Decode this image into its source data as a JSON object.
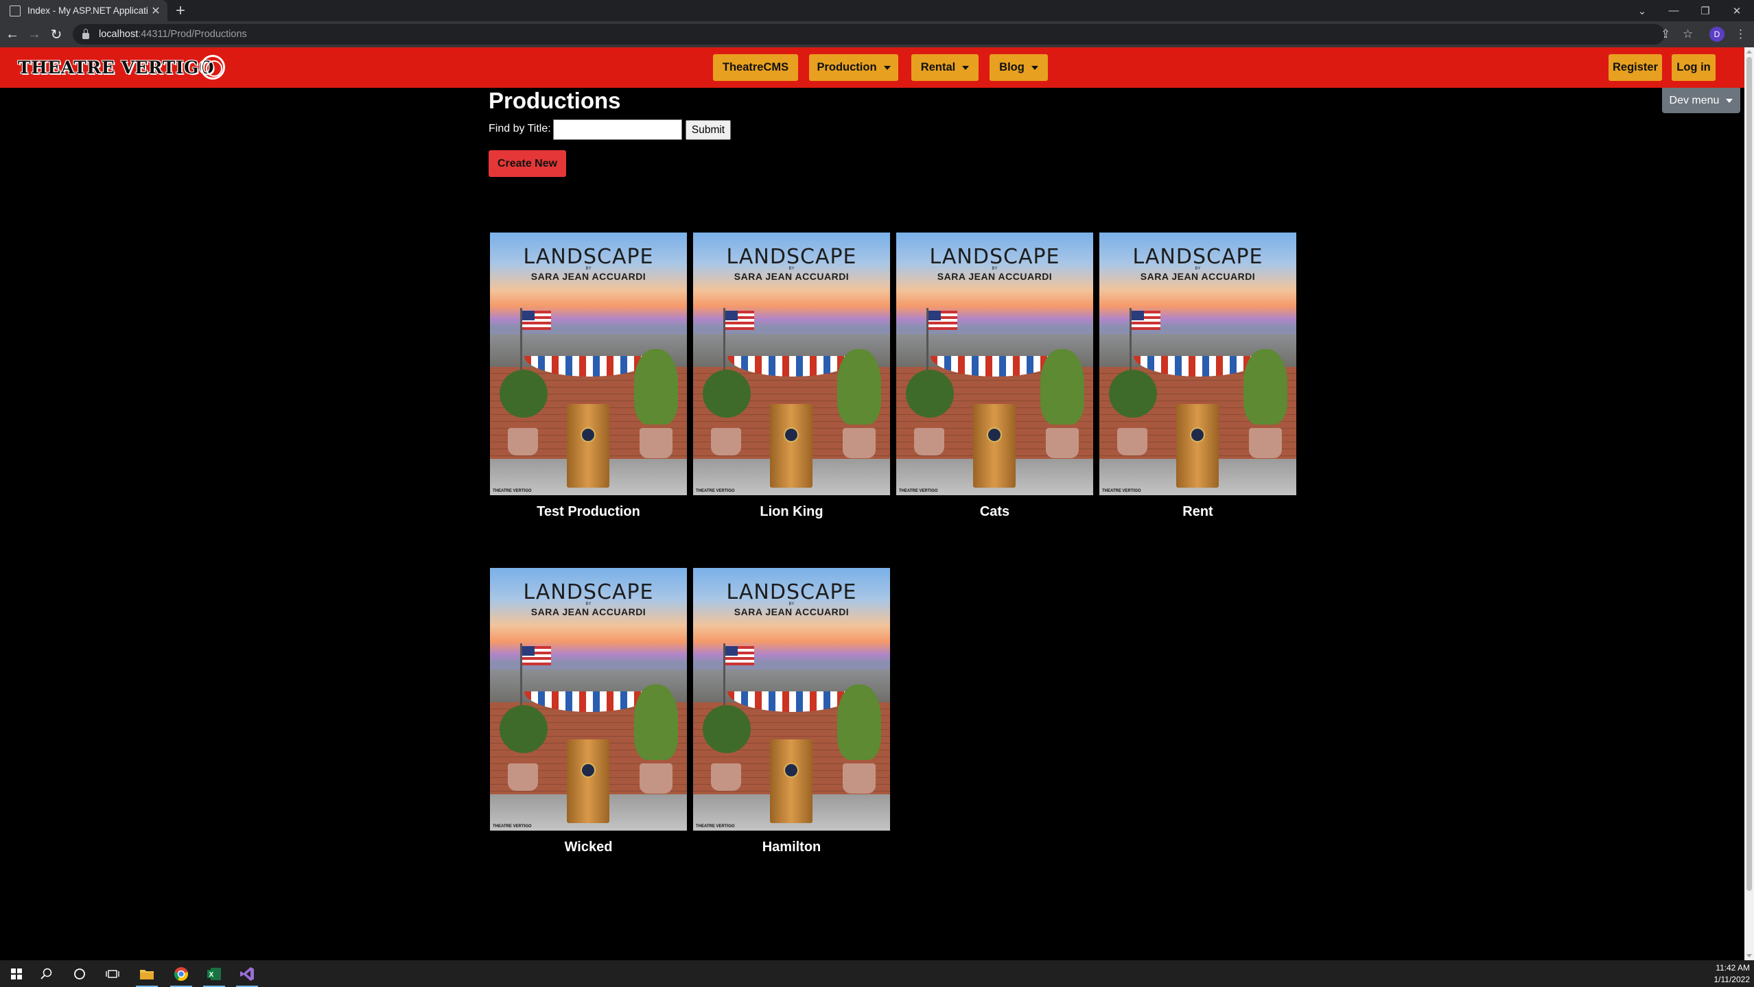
{
  "browser": {
    "tab_title": "Index - My ASP.NET Application",
    "url_host": "localhost",
    "url_path": ":44311/Prod/Productions",
    "profile_initial": "D"
  },
  "navbar": {
    "logo_text": "THEATRE VERTIGO",
    "items": [
      {
        "label": "TheatreCMS",
        "dropdown": false
      },
      {
        "label": "Production",
        "dropdown": true
      },
      {
        "label": "Rental",
        "dropdown": true
      },
      {
        "label": "Blog",
        "dropdown": true
      }
    ],
    "register_label": "Register",
    "login_label": "Log in",
    "accent_color": "#dc1a12",
    "button_color": "#e8a020"
  },
  "dev_menu_label": "Dev menu",
  "page": {
    "title": "Productions",
    "search_label": "Find by Title:",
    "search_value": "",
    "submit_label": "Submit",
    "create_label": "Create New"
  },
  "poster": {
    "title": "LANDSCAPE",
    "by": "BY",
    "author": "SARA JEAN ACCUARDI",
    "footer": "THEATRE VERTIGO"
  },
  "productions": [
    {
      "title": "Test Production"
    },
    {
      "title": "Lion King"
    },
    {
      "title": "Cats"
    },
    {
      "title": "Rent"
    },
    {
      "title": "Wicked"
    },
    {
      "title": "Hamilton"
    }
  ],
  "taskbar": {
    "time": "11:42 AM",
    "date": "1/11/2022"
  }
}
